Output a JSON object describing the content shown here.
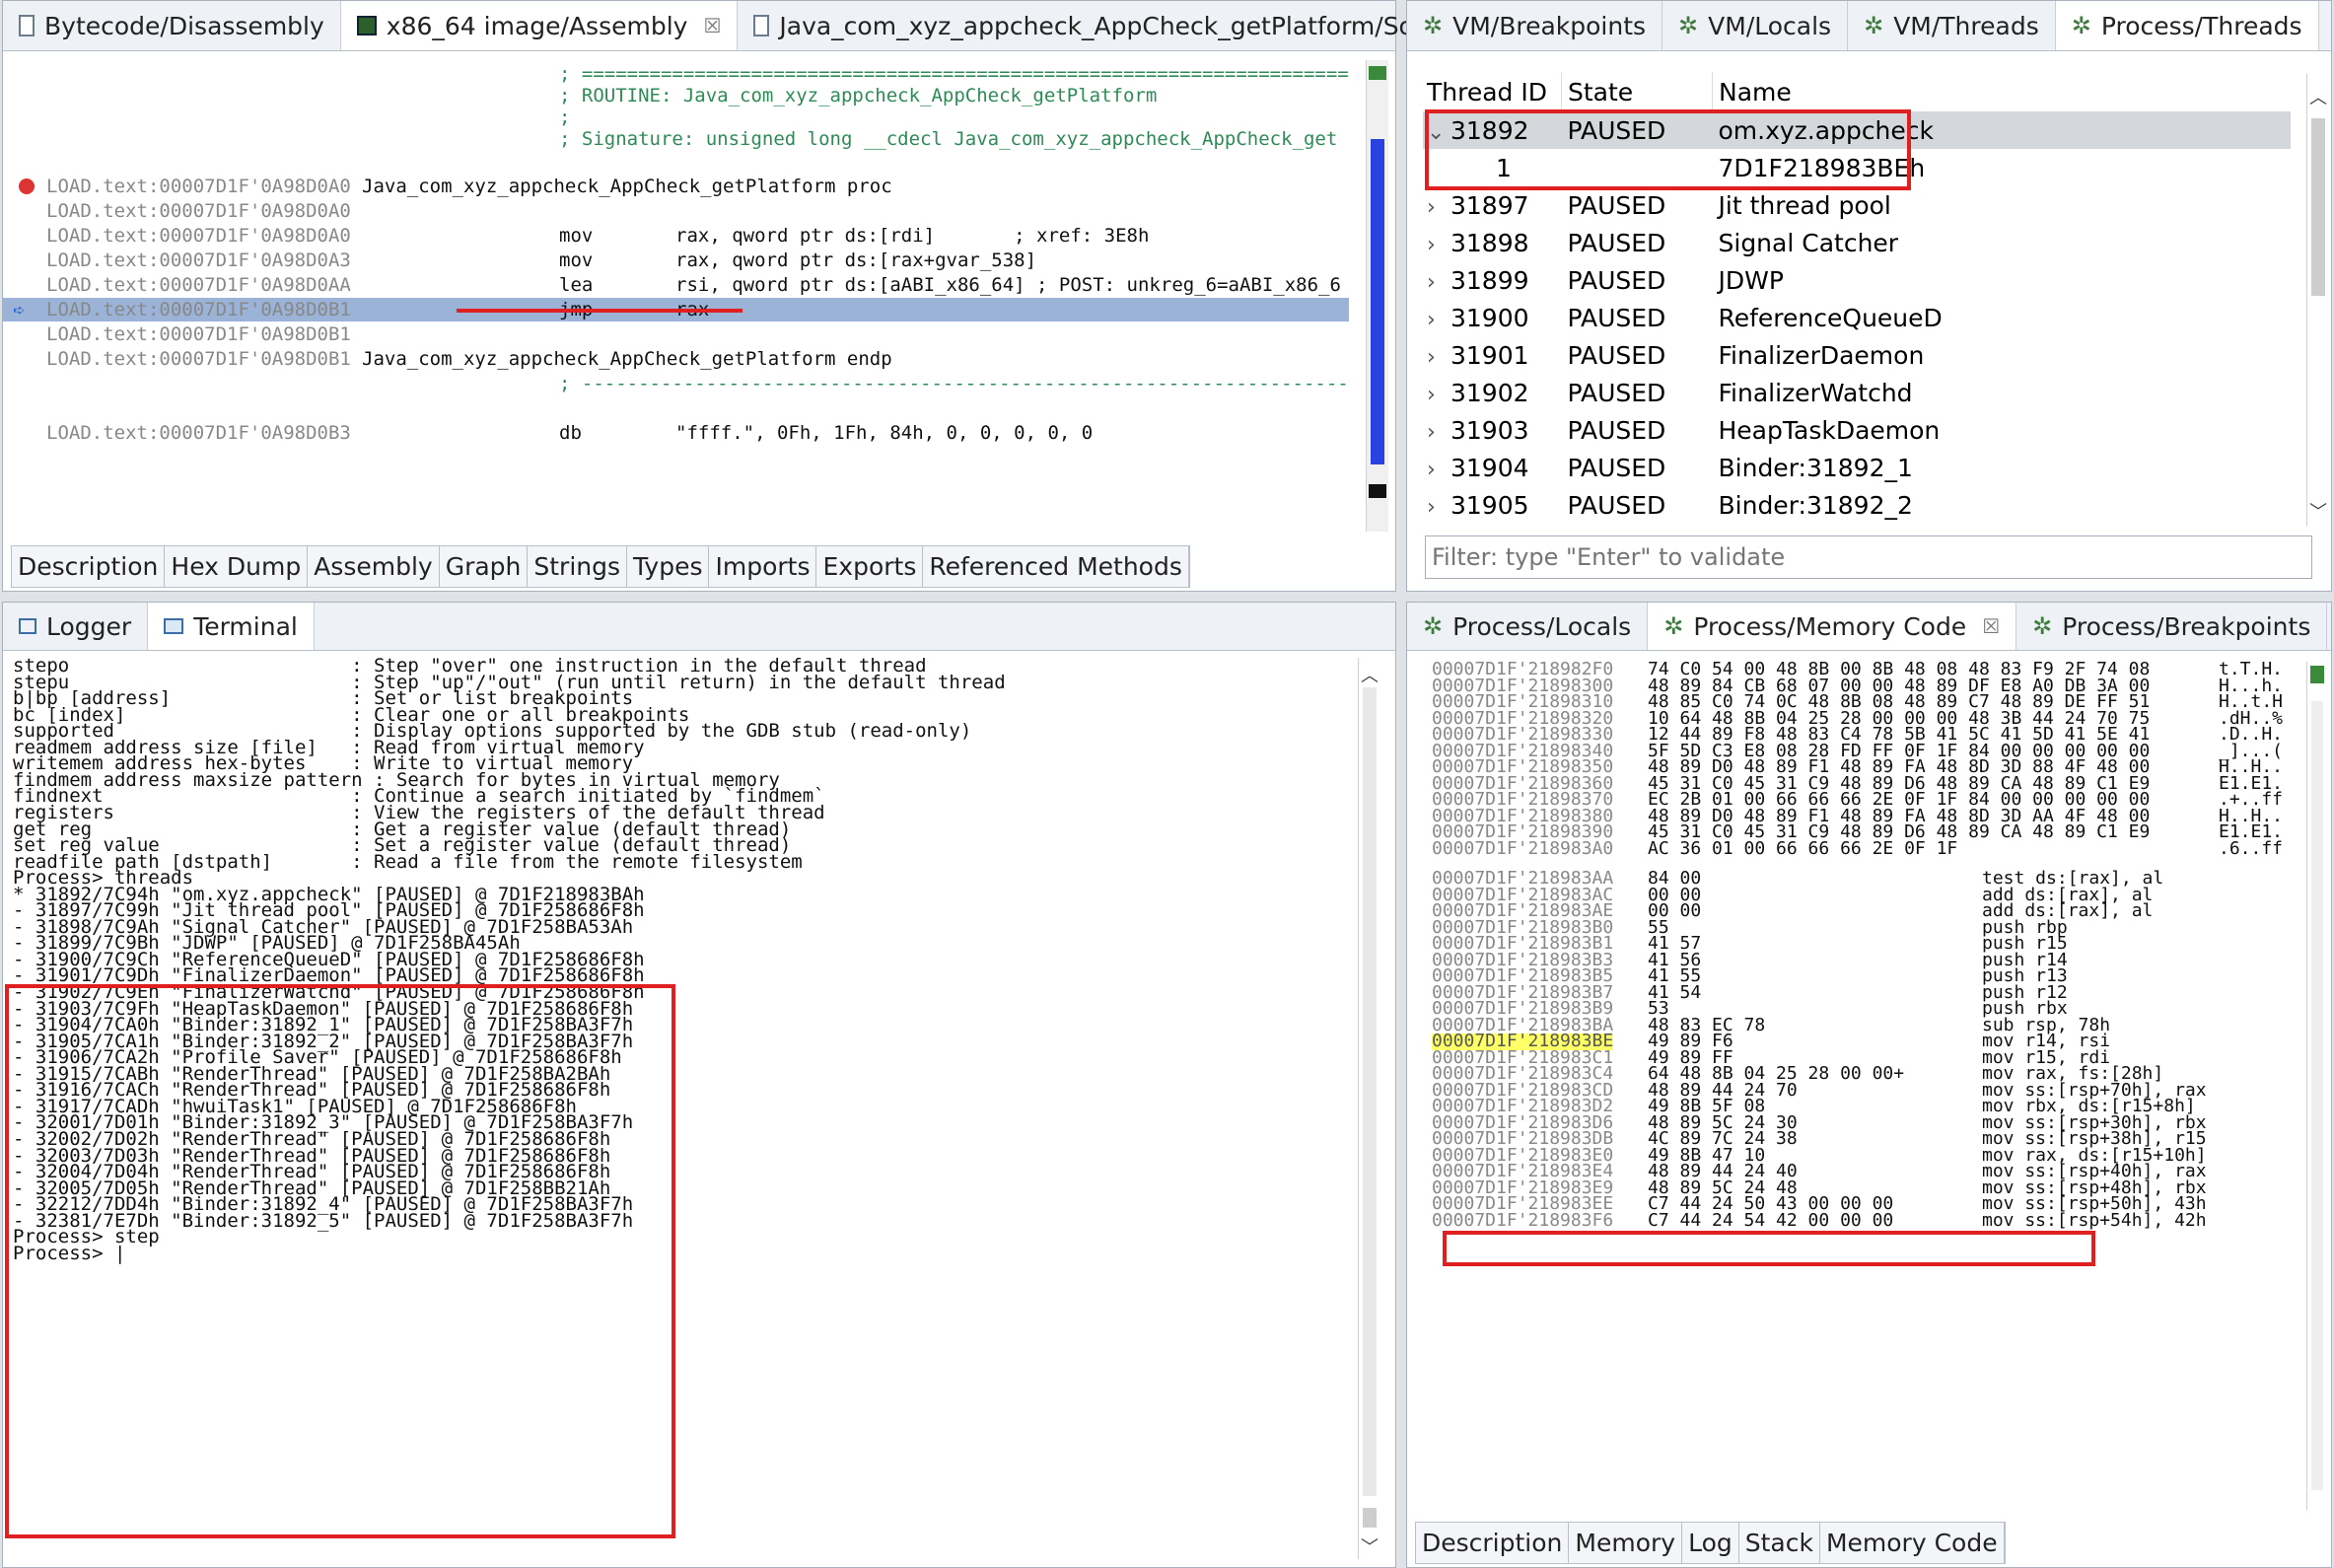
{
  "editor": {
    "tabs": [
      {
        "label": "Bytecode/Disassembly",
        "icon": "document-icon"
      },
      {
        "label": "x86_64 image/Assembly",
        "icon": "binary-image-icon"
      },
      {
        "label": "Java_com_xyz_appcheck_AppCheck_getPlatform/Source",
        "icon": "document-icon"
      }
    ],
    "close_glyph": "☒",
    "lines": [
      {
        "addr": "",
        "op": "",
        "args": "; ========================================================================",
        "kind": "comment"
      },
      {
        "addr": "",
        "op": "",
        "args": "; ROUTINE: Java_com_xyz_appcheck_AppCheck_getPlatform",
        "kind": "comment"
      },
      {
        "addr": "",
        "op": "",
        "args": ";",
        "kind": "comment"
      },
      {
        "addr": "",
        "op": "",
        "args": "; Signature: unsigned long __cdecl Java_com_xyz_appcheck_AppCheck_get",
        "kind": "comment"
      },
      {
        "addr": "",
        "op": "",
        "args": "",
        "kind": "blank"
      },
      {
        "addr": "LOAD.text:00007D1F'0A98D0A0",
        "op": "Java_com_xyz_appcheck_AppCheck_getPlatform proc",
        "args": "",
        "kind": "label"
      },
      {
        "addr": "LOAD.text:00007D1F'0A98D0A0",
        "op": "",
        "args": "",
        "kind": "plain"
      },
      {
        "addr": "LOAD.text:00007D1F'0A98D0A0",
        "op": "mov",
        "args": "rax, qword ptr ds:[rdi]       ; xref: 3E8h",
        "kind": "instr"
      },
      {
        "addr": "LOAD.text:00007D1F'0A98D0A3",
        "op": "mov",
        "args": "rax, qword ptr ds:[rax+gvar_538]",
        "kind": "instr"
      },
      {
        "addr": "LOAD.text:00007D1F'0A98D0AA",
        "op": "lea",
        "args": "rsi, qword ptr ds:[aABI_x86_64] ; POST: unkreg_6=aABI_x86_6",
        "kind": "instr"
      },
      {
        "addr": "LOAD.text:00007D1F'0A98D0B1",
        "op": "jmp",
        "args": "rax",
        "kind": "current"
      },
      {
        "addr": "LOAD.text:00007D1F'0A98D0B1",
        "op": "",
        "args": "",
        "kind": "plain"
      },
      {
        "addr": "LOAD.text:00007D1F'0A98D0B1",
        "op": "Java_com_xyz_appcheck_AppCheck_getPlatform endp",
        "args": "",
        "kind": "label"
      },
      {
        "addr": "",
        "op": "",
        "args": "; ------------------------------------------------------------------------",
        "kind": "comment"
      },
      {
        "addr": "",
        "op": "",
        "args": "",
        "kind": "blank"
      },
      {
        "addr": "LOAD.text:00007D1F'0A98D0B3",
        "op": "db",
        "args": "\"ffff.\", 0Fh, 1Fh, 84h, 0, 0, 0, 0, 0",
        "kind": "instr"
      }
    ],
    "bottom_tabs": [
      "Description",
      "Hex Dump",
      "Assembly",
      "Graph",
      "Strings",
      "Types",
      "Imports",
      "Exports",
      "Referenced Methods"
    ]
  },
  "vm_panel": {
    "tabs": [
      "VM/Breakpoints",
      "VM/Locals",
      "VM/Threads",
      "Process/Threads"
    ],
    "columns": [
      "Thread ID",
      "State",
      "Name"
    ],
    "rows": [
      {
        "id": "31892",
        "state": "PAUSED",
        "name": "om.xyz.appcheck",
        "expanded": true
      },
      {
        "id": "1",
        "state": "",
        "name": "7D1F218983BEh",
        "child": true
      },
      {
        "id": "31897",
        "state": "PAUSED",
        "name": "Jit thread pool"
      },
      {
        "id": "31898",
        "state": "PAUSED",
        "name": "Signal Catcher"
      },
      {
        "id": "31899",
        "state": "PAUSED",
        "name": "JDWP"
      },
      {
        "id": "31900",
        "state": "PAUSED",
        "name": "ReferenceQueueD"
      },
      {
        "id": "31901",
        "state": "PAUSED",
        "name": "FinalizerDaemon"
      },
      {
        "id": "31902",
        "state": "PAUSED",
        "name": "FinalizerWatchd"
      },
      {
        "id": "31903",
        "state": "PAUSED",
        "name": "HeapTaskDaemon"
      },
      {
        "id": "31904",
        "state": "PAUSED",
        "name": "Binder:31892_1"
      },
      {
        "id": "31905",
        "state": "PAUSED",
        "name": "Binder:31892_2"
      }
    ],
    "filter_placeholder": "Filter: type \"Enter\" to validate"
  },
  "console": {
    "tabs": [
      "Logger",
      "Terminal"
    ],
    "lines": [
      "stepo                         : Step \"over\" one instruction in the default thread",
      "stepu                         : Step \"up\"/\"out\" (run until return) in the default thread",
      "b|bp [address]                : Set or list breakpoints",
      "bc [index]                    : Clear one or all breakpoints",
      "supported                     : Display options supported by the GDB stub (read-only)",
      "readmem address size [file]   : Read from virtual memory",
      "writemem address hex-bytes    : Write to virtual memory",
      "findmem address maxsize pattern : Search for bytes in virtual memory",
      "findnext                      : Continue a search initiated by `findmem`",
      "registers                     : View the registers of the default thread",
      "get reg                       : Get a register value (default thread)",
      "set reg value                 : Set a register value (default thread)",
      "readfile path [dstpath]       : Read a file from the remote filesystem",
      "Process> threads",
      "* 31892/7C94h \"om.xyz.appcheck\" [PAUSED] @ 7D1F218983BAh",
      "- 31897/7C99h \"Jit thread pool\" [PAUSED] @ 7D1F258686F8h",
      "- 31898/7C9Ah \"Signal Catcher\" [PAUSED] @ 7D1F258BA53Ah",
      "- 31899/7C9Bh \"JDWP\" [PAUSED] @ 7D1F258BA45Ah",
      "- 31900/7C9Ch \"ReferenceQueueD\" [PAUSED] @ 7D1F258686F8h",
      "- 31901/7C9Dh \"FinalizerDaemon\" [PAUSED] @ 7D1F258686F8h",
      "- 31902/7C9Eh \"FinalizerWatchd\" [PAUSED] @ 7D1F258686F8h",
      "- 31903/7C9Fh \"HeapTaskDaemon\" [PAUSED] @ 7D1F258686F8h",
      "- 31904/7CA0h \"Binder:31892_1\" [PAUSED] @ 7D1F258BA3F7h",
      "- 31905/7CA1h \"Binder:31892_2\" [PAUSED] @ 7D1F258BA3F7h",
      "- 31906/7CA2h \"Profile Saver\" [PAUSED] @ 7D1F258686F8h",
      "- 31915/7CABh \"RenderThread\" [PAUSED] @ 7D1F258BA2BAh",
      "- 31916/7CACh \"RenderThread\" [PAUSED] @ 7D1F258686F8h",
      "- 31917/7CADh \"hwuiTask1\" [PAUSED] @ 7D1F258686F8h",
      "- 32001/7D01h \"Binder:31892_3\" [PAUSED] @ 7D1F258BA3F7h",
      "- 32002/7D02h \"RenderThread\" [PAUSED] @ 7D1F258686F8h",
      "- 32003/7D03h \"RenderThread\" [PAUSED] @ 7D1F258686F8h",
      "- 32004/7D04h \"RenderThread\" [PAUSED] @ 7D1F258686F8h",
      "- 32005/7D05h \"RenderThread\" [PAUSED] @ 7D1F258BB21Ah",
      "- 32212/7DD4h \"Binder:31892_4\" [PAUSED] @ 7D1F258BA3F7h",
      "- 32381/7E7Dh \"Binder:31892_5\" [PAUSED] @ 7D1F258BA3F7h",
      "Process> step",
      "Process> |"
    ]
  },
  "memory_panel": {
    "tabs": [
      "Process/Locals",
      "Process/Memory Code",
      "Process/Breakpoints"
    ],
    "hex_rows": [
      {
        "addr": "00007D1F'218982F0",
        "bytes": "74 C0 54 00 48 8B 00 8B 48 08 48 83 F9 2F 74 08",
        "ascii": "t.T.H."
      },
      {
        "addr": "00007D1F'21898300",
        "bytes": "48 89 84 CB 68 07 00 00 48 89 DF E8 A0 DB 3A 00",
        "ascii": "H...h."
      },
      {
        "addr": "00007D1F'21898310",
        "bytes": "48 85 C0 74 0C 48 8B 08 48 89 C7 48 89 DE FF 51",
        "ascii": "H..t.H"
      },
      {
        "addr": "00007D1F'21898320",
        "bytes": "10 64 48 8B 04 25 28 00 00 00 48 3B 44 24 70 75",
        "ascii": ".dH..%"
      },
      {
        "addr": "00007D1F'21898330",
        "bytes": "12 44 89 F8 48 83 C4 78 5B 41 5C 41 5D 41 5E 41",
        "ascii": ".D..H."
      },
      {
        "addr": "00007D1F'21898340",
        "bytes": "5F 5D C3 E8 08 28 FD FF 0F 1F 84 00 00 00 00 00",
        "ascii": "_]...("
      },
      {
        "addr": "00007D1F'21898350",
        "bytes": "48 89 D0 48 89 F1 48 89 FA 48 8D 3D 88 4F 48 00",
        "ascii": "H..H.."
      },
      {
        "addr": "00007D1F'21898360",
        "bytes": "45 31 C0 45 31 C9 48 89 D6 48 89 CA 48 89 C1 E9",
        "ascii": "E1.E1."
      },
      {
        "addr": "00007D1F'21898370",
        "bytes": "EC 2B 01 00 66 66 66 2E 0F 1F 84 00 00 00 00 00",
        "ascii": ".+..ff"
      },
      {
        "addr": "00007D1F'21898380",
        "bytes": "48 89 D0 48 89 F1 48 89 FA 48 8D 3D AA 4F 48 00",
        "ascii": "H..H.."
      },
      {
        "addr": "00007D1F'21898390",
        "bytes": "45 31 C0 45 31 C9 48 89 D6 48 89 CA 48 89 C1 E9",
        "ascii": "E1.E1."
      },
      {
        "addr": "00007D1F'218983A0",
        "bytes": "AC 36 01 00 66 66 66 2E 0F 1F",
        "ascii": ".6..ff"
      }
    ],
    "code_rows": [
      {
        "addr": "00007D1F'218983AA",
        "bytes": "84 00",
        "asm": "test ds:[rax], al"
      },
      {
        "addr": "00007D1F'218983AC",
        "bytes": "00 00",
        "asm": "add ds:[rax], al"
      },
      {
        "addr": "00007D1F'218983AE",
        "bytes": "00 00",
        "asm": "add ds:[rax], al"
      },
      {
        "addr": "00007D1F'218983B0",
        "bytes": "55",
        "asm": "push rbp"
      },
      {
        "addr": "00007D1F'218983B1",
        "bytes": "41 57",
        "asm": "push r15"
      },
      {
        "addr": "00007D1F'218983B3",
        "bytes": "41 56",
        "asm": "push r14"
      },
      {
        "addr": "00007D1F'218983B5",
        "bytes": "41 55",
        "asm": "push r13"
      },
      {
        "addr": "00007D1F'218983B7",
        "bytes": "41 54",
        "asm": "push r12"
      },
      {
        "addr": "00007D1F'218983B9",
        "bytes": "53",
        "asm": "push rbx"
      },
      {
        "addr": "00007D1F'218983BA",
        "bytes": "48 83 EC 78",
        "asm": "sub rsp, 78h"
      },
      {
        "addr": "00007D1F'218983BE",
        "bytes": "49 89 F6",
        "asm": "mov r14, rsi",
        "current": true
      },
      {
        "addr": "00007D1F'218983C1",
        "bytes": "49 89 FF",
        "asm": "mov r15, rdi"
      },
      {
        "addr": "00007D1F'218983C4",
        "bytes": "64 48 8B 04 25 28 00 00+",
        "asm": "mov rax, fs:[28h]"
      },
      {
        "addr": "00007D1F'218983CD",
        "bytes": "48 89 44 24 70",
        "asm": "mov ss:[rsp+70h], rax"
      },
      {
        "addr": "00007D1F'218983D2",
        "bytes": "49 8B 5F 08",
        "asm": "mov rbx, ds:[r15+8h]"
      },
      {
        "addr": "00007D1F'218983D6",
        "bytes": "48 89 5C 24 30",
        "asm": "mov ss:[rsp+30h], rbx"
      },
      {
        "addr": "00007D1F'218983DB",
        "bytes": "4C 89 7C 24 38",
        "asm": "mov ss:[rsp+38h], r15"
      },
      {
        "addr": "00007D1F'218983E0",
        "bytes": "49 8B 47 10",
        "asm": "mov rax, ds:[r15+10h]"
      },
      {
        "addr": "00007D1F'218983E4",
        "bytes": "48 89 44 24 40",
        "asm": "mov ss:[rsp+40h], rax"
      },
      {
        "addr": "00007D1F'218983E9",
        "bytes": "48 89 5C 24 48",
        "asm": "mov ss:[rsp+48h], rbx"
      },
      {
        "addr": "00007D1F'218983EE",
        "bytes": "C7 44 24 50 43 00 00 00",
        "asm": "mov ss:[rsp+50h], 43h"
      },
      {
        "addr": "00007D1F'218983F6",
        "bytes": "C7 44 24 54 42 00 00 00",
        "asm": "mov ss:[rsp+54h], 42h"
      }
    ],
    "bottom_tabs": [
      "Description",
      "Memory",
      "Log",
      "Stack",
      "Memory Code"
    ]
  },
  "colors": {
    "highlight_red": "#e02020",
    "selection_blue": "#9bb3d6",
    "current_yellow": "#ffff66",
    "comment_green": "#2e8b57"
  }
}
